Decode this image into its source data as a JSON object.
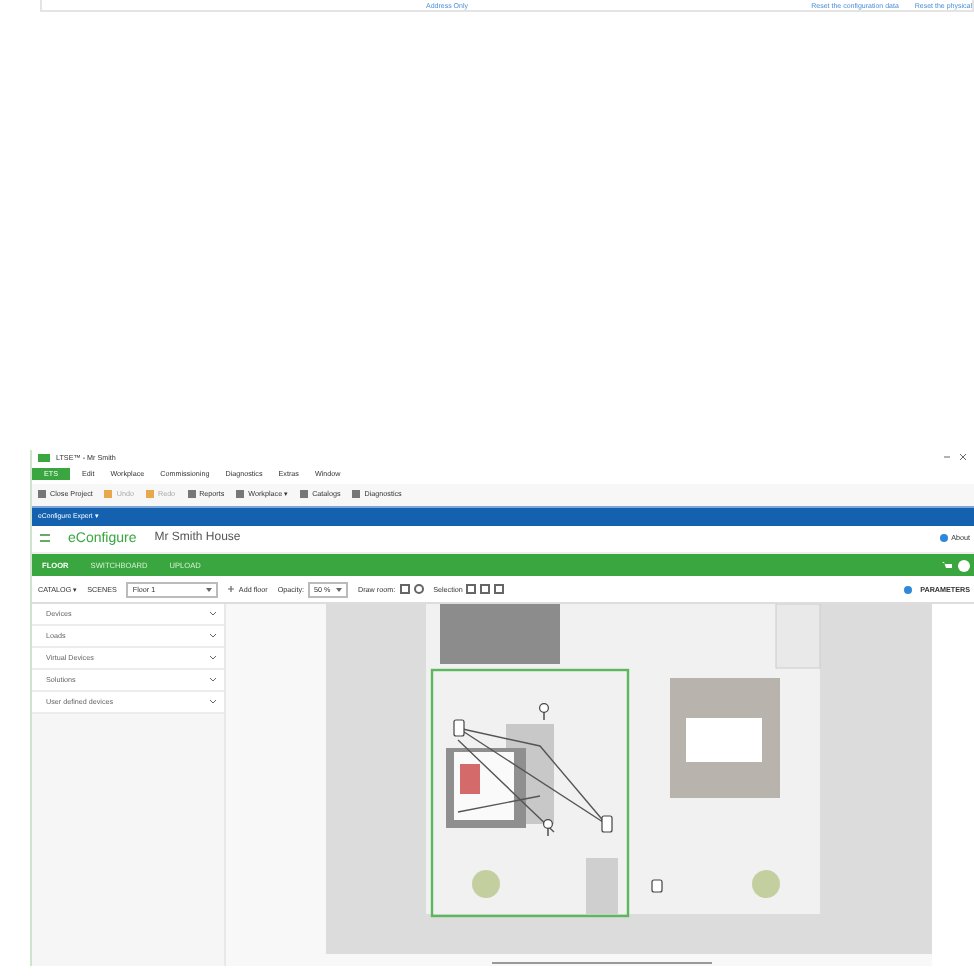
{
  "top_card": {
    "links": [
      "Address Only",
      "Reset the configuration data",
      "Reset the physical"
    ]
  },
  "window": {
    "title": "LTSE™ - Mr Smith"
  },
  "menu": [
    {
      "label": "ETS",
      "selected": true
    },
    {
      "label": "Edit",
      "selected": false
    },
    {
      "label": "Workplace",
      "selected": false
    },
    {
      "label": "Commissioning",
      "selected": false
    },
    {
      "label": "Diagnostics",
      "selected": false
    },
    {
      "label": "Extras",
      "selected": false
    },
    {
      "label": "Window",
      "selected": false
    }
  ],
  "toolbar": [
    {
      "label": "Close Project",
      "disabled": false
    },
    {
      "label": "Undo",
      "disabled": true
    },
    {
      "label": "Redo",
      "disabled": true
    },
    {
      "label": "Reports",
      "disabled": false
    },
    {
      "label": "Workplace ▾",
      "disabled": false
    },
    {
      "label": "Catalogs",
      "disabled": false
    },
    {
      "label": "Diagnostics",
      "disabled": false
    }
  ],
  "panel_tab": "eConfigure Expert ▾",
  "app": {
    "brand": "eConfigure",
    "project": "Mr Smith House",
    "about": "About"
  },
  "nav": [
    {
      "label": "FLOOR",
      "selected": true
    },
    {
      "label": "SWITCHBOARD",
      "selected": false
    },
    {
      "label": "UPLOAD",
      "selected": false
    }
  ],
  "floor_toolbar": {
    "catalog": "CATALOG ▾",
    "scenes": "SCENES",
    "floor": "Floor 1",
    "add_floor": "Add floor",
    "opacity_label": "Opacity:",
    "opacity": "50 %",
    "draw_room": "Draw room:",
    "selection": "Selection",
    "parameters": "PARAMETERS"
  },
  "catalog": [
    "Devices",
    "Loads",
    "Virtual Devices",
    "Solutions",
    "User defined devices"
  ]
}
